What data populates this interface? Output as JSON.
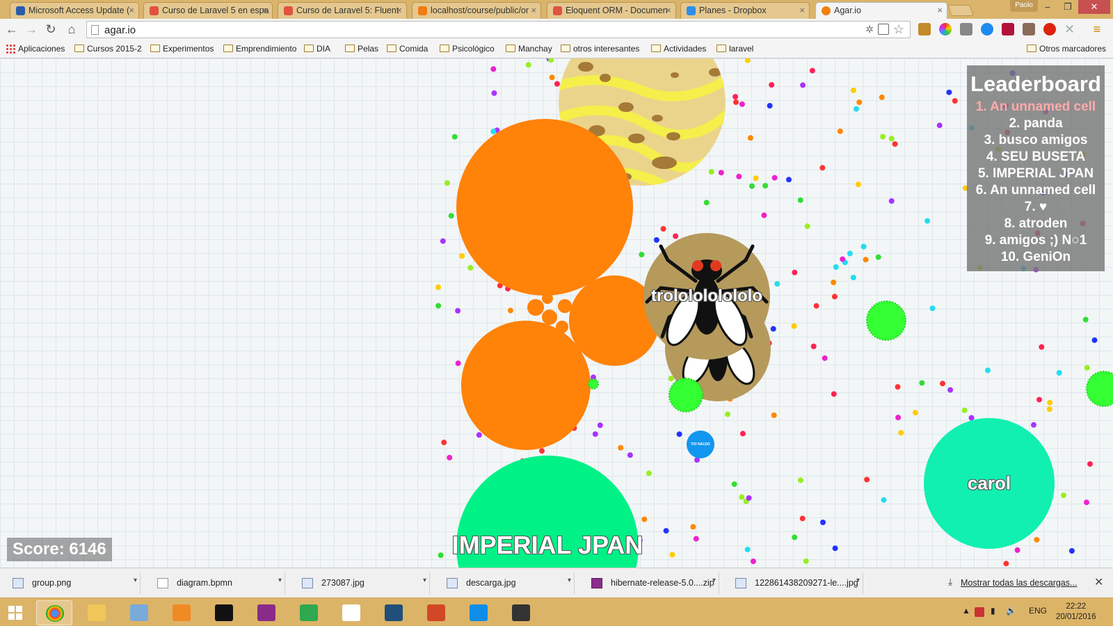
{
  "browser": {
    "tabs": [
      {
        "title": "Microsoft Access Update (",
        "favicon": "access-favicon",
        "color": "#2a5caa"
      },
      {
        "title": "Curso de Laravel 5 en espa",
        "favicon": "laravel-favicon",
        "color": "#e0533f"
      },
      {
        "title": "Curso de Laravel 5: Fluent",
        "favicon": "laravel-favicon",
        "color": "#e0533f"
      },
      {
        "title": "localhost/course/public/or",
        "favicon": "xampp-favicon",
        "color": "#f07b12"
      },
      {
        "title": "Eloquent ORM - Documen",
        "favicon": "laravel-favicon",
        "color": "#e0533f"
      },
      {
        "title": "Planes - Dropbox",
        "favicon": "dropbox-favicon",
        "color": "#2e8ee8"
      },
      {
        "title": "Agar.io",
        "favicon": "agario-favicon",
        "color": "#f08010",
        "active": true
      }
    ],
    "profile_name": "Paolo",
    "url": "agar.io",
    "bookmarks": [
      {
        "label": "Aplicaciones",
        "type": "apps"
      },
      {
        "label": "Cursos 2015-2",
        "type": "folder"
      },
      {
        "label": "Experimentos",
        "type": "folder"
      },
      {
        "label": "Emprendimiento",
        "type": "folder"
      },
      {
        "label": "DIA",
        "type": "folder"
      },
      {
        "label": "Pelas",
        "type": "folder"
      },
      {
        "label": "Comida",
        "type": "folder"
      },
      {
        "label": "Psicológico",
        "type": "folder"
      },
      {
        "label": "Manchay",
        "type": "folder"
      },
      {
        "label": "otros interesantes",
        "type": "folder"
      },
      {
        "label": "Actividades",
        "type": "folder"
      },
      {
        "label": "laravel",
        "type": "folder"
      }
    ],
    "other_bookmarks": "Otros marcadores"
  },
  "game": {
    "leaderboard_title": "Leaderboard",
    "leaderboard": [
      "1. An unnamed cell",
      "2. panda",
      "3. busco amigos",
      "4. SEU BUSETA",
      "5. IMPERIAL JPAN",
      "6. An unnamed cell",
      "7. ♥",
      "8. atroden",
      "9. amigos ;) N○1",
      "10. GeniOn"
    ],
    "score_text": "Score: 6146",
    "cells": {
      "fly_player": "trololololololo",
      "green_player": "IMPERIAL JPAN",
      "teal_player": "carol",
      "small_blue": "TIO NALDO"
    },
    "colors": {
      "player": "#ff8209",
      "green_big": "#00f287",
      "teal": "#11f0b1",
      "virus": "#33ff33",
      "blue_cell": "#1396ef"
    }
  },
  "downloads": {
    "items": [
      {
        "name": "group.png",
        "icon": "image-file-icon"
      },
      {
        "name": "diagram.bpmn",
        "icon": "file-icon"
      },
      {
        "name": "273087.jpg",
        "icon": "image-file-icon"
      },
      {
        "name": "descarga.jpg",
        "icon": "image-file-icon"
      },
      {
        "name": "hibernate-release-5.0....zip",
        "icon": "archive-icon"
      },
      {
        "name": "122861438209271-le....jpg",
        "icon": "image-file-icon"
      }
    ],
    "show_all": "Mostrar todas las descargas..."
  },
  "taskbar": {
    "apps": [
      "chrome",
      "file-explorer",
      "control-panel",
      "sublime-orange",
      "command-prompt",
      "phpstorm",
      "heidisql",
      "apps-grid",
      "mysql-workbench",
      "powerpoint",
      "teamviewer",
      "sublime-text"
    ],
    "language": "ENG",
    "time": "22:22",
    "date": "20/01/2016"
  }
}
